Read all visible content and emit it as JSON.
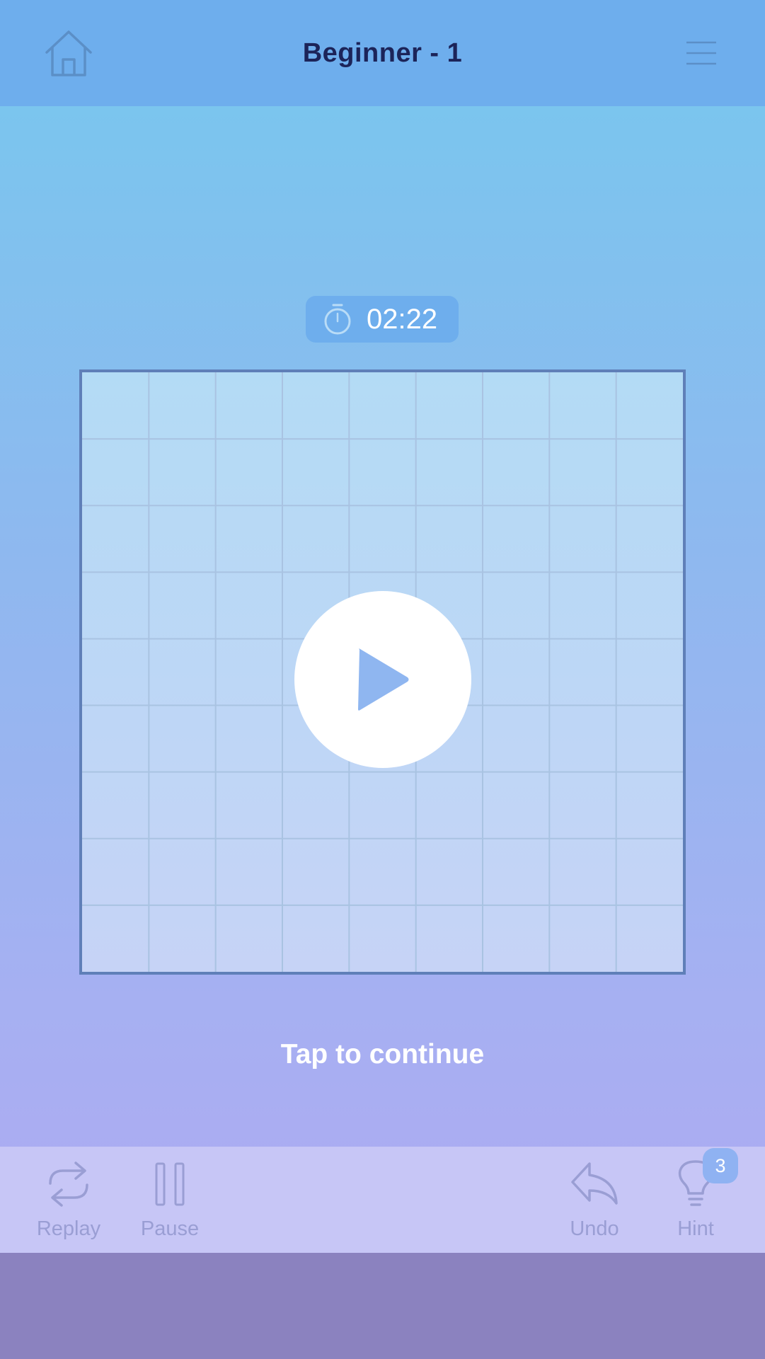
{
  "header": {
    "title": "Beginner - 1",
    "home_icon": "home-icon",
    "menu_icon": "hamburger-menu-icon"
  },
  "timer": {
    "icon": "stopwatch-icon",
    "value": "02:22"
  },
  "board": {
    "rows": 9,
    "cols": 9
  },
  "overlay": {
    "play_icon": "play-icon",
    "tap_text": "Tap to continue"
  },
  "toolbar": {
    "replay_label": "Replay",
    "pause_label": "Pause",
    "undo_label": "Undo",
    "hint_label": "Hint",
    "hint_count": "3"
  },
  "colors": {
    "header_bg": "#6eaeed",
    "title": "#1c2459",
    "toolbar_bg": "#c7c6f6",
    "toolbar_icon": "#9a9ed4",
    "board_border": "#5f7fb8",
    "badge": "#8fb2f2"
  }
}
